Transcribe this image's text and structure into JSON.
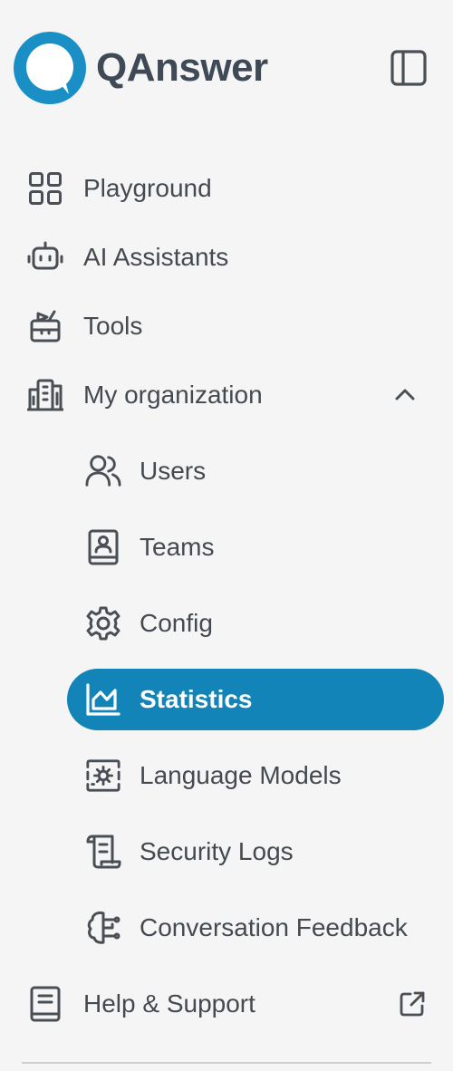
{
  "brand": {
    "name": "QAnswer",
    "logo_color": "#1a8fc6"
  },
  "nav": {
    "playground": "Playground",
    "assistants": "AI Assistants",
    "tools": "Tools",
    "organization": "My organization",
    "org_items": {
      "users": "Users",
      "teams": "Teams",
      "config": "Config",
      "statistics": "Statistics",
      "models": "Language Models",
      "security": "Security Logs",
      "feedback": "Conversation Feedback"
    },
    "help": "Help & Support"
  },
  "colors": {
    "active_bg": "#1384b8",
    "text": "#444a50",
    "icon": "#4a4f55"
  },
  "icons": {
    "playground": "grid-icon",
    "assistants": "robot-icon",
    "tools": "toolbox-icon",
    "organization": "building-icon",
    "users": "users-icon",
    "teams": "contact-book-icon",
    "config": "gear-icon",
    "statistics": "chart-area-icon",
    "models": "model-settings-icon",
    "security": "scroll-log-icon",
    "feedback": "brain-feedback-icon",
    "help": "book-icon"
  }
}
